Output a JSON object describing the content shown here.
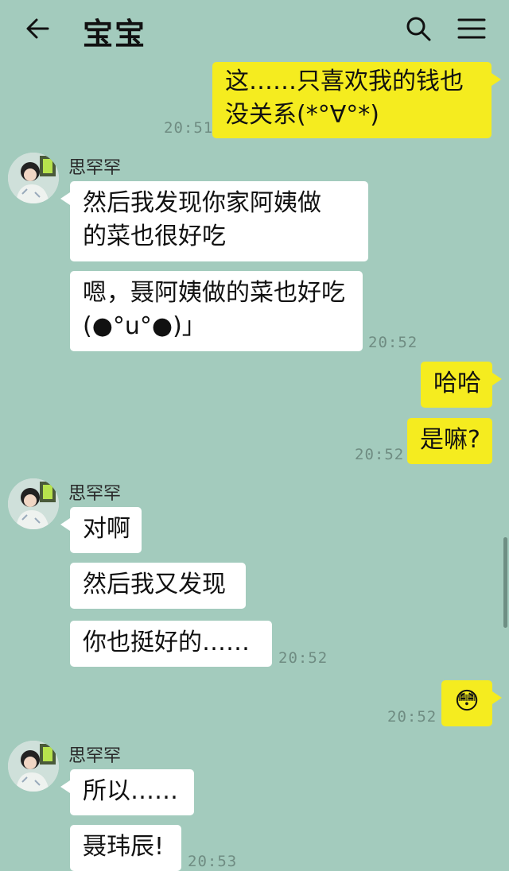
{
  "header": {
    "title": "宝宝",
    "back_icon": "arrow-left-icon",
    "search_icon": "search-icon",
    "menu_icon": "hamburger-menu-icon"
  },
  "contact": {
    "name": "思罕罕"
  },
  "colors": {
    "background": "#a3cbbd",
    "incoming_bubble": "#ffffff",
    "outgoing_bubble": "#f5ec1f",
    "timestamp": "#6f8c82"
  },
  "messages": [
    {
      "from": "me",
      "lines": [
        "这……只喜欢我的钱也",
        "没关系(*°∀°*)"
      ],
      "time": "20:51"
    },
    {
      "from": "contact",
      "lines": [
        "然后我发现你家阿姨做",
        "的菜也很好吃"
      ]
    },
    {
      "from": "contact",
      "lines": [
        "嗯，聂阿姨做的菜也好吃",
        "(●°u°●)」"
      ],
      "time": "20:52"
    },
    {
      "from": "me",
      "lines": [
        "哈哈"
      ]
    },
    {
      "from": "me",
      "lines": [
        "是嘛?"
      ],
      "time": "20:52"
    },
    {
      "from": "contact",
      "lines": [
        "对啊"
      ]
    },
    {
      "from": "contact",
      "lines": [
        "然后我又发现"
      ]
    },
    {
      "from": "contact",
      "lines": [
        "你也挺好的……"
      ],
      "time": "20:52"
    },
    {
      "from": "me",
      "lines": [
        "😳"
      ],
      "time": "20:52"
    },
    {
      "from": "contact",
      "lines": [
        "所以……"
      ]
    },
    {
      "from": "contact",
      "lines": [
        "聂玮辰!"
      ],
      "time": "20:53"
    }
  ]
}
